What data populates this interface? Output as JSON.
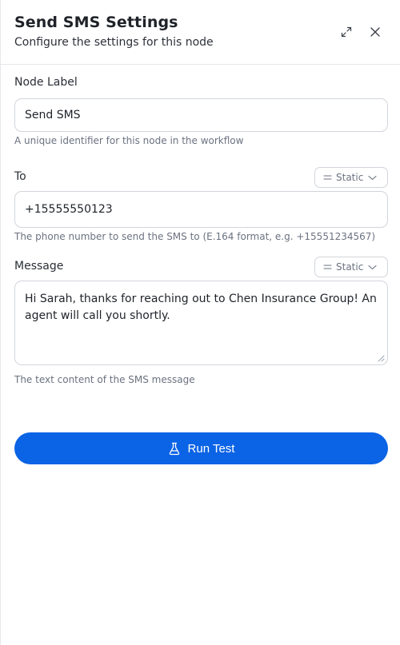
{
  "header": {
    "title": "Send SMS Settings",
    "subtitle": "Configure the settings for this node",
    "expand_icon": "expand-icon",
    "close_icon": "close-icon"
  },
  "fields": {
    "node_label": {
      "label": "Node Label",
      "value": "Send SMS",
      "hint": "A unique identifier for this node in the workflow"
    },
    "to": {
      "label": "To",
      "mode": "Static",
      "value": "+15555550123",
      "hint": "The phone number to send the SMS to (E.164 format, e.g. +15551234567)"
    },
    "message": {
      "label": "Message",
      "mode": "Static",
      "value": "Hi Sarah, thanks for reaching out to Chen Insurance Group! An agent will call you shortly.",
      "hint": "The text content of the SMS message"
    }
  },
  "actions": {
    "run_test_label": "Run Test",
    "run_test_icon": "flask-icon"
  },
  "colors": {
    "accent": "#0b63e5",
    "border": "#d1d5db",
    "hint_text": "#6b7280"
  }
}
